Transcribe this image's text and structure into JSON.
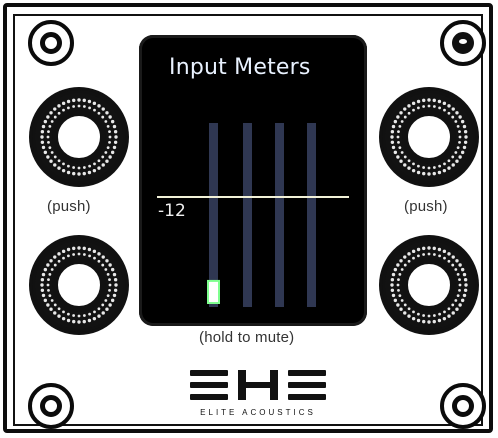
{
  "display": {
    "title": "Input Meters",
    "threshold_label": "-12"
  },
  "labels": {
    "push_left": "(push)",
    "push_right": "(push)",
    "hold_mute": "(hold to mute)"
  },
  "brand": {
    "name": "ELITE ACOUSTICS"
  },
  "meters": [
    {
      "level": 0.12,
      "active": true
    },
    {
      "level": 0.0,
      "active": false
    },
    {
      "level": 0.0,
      "active": false
    },
    {
      "level": 0.0,
      "active": false
    }
  ],
  "colors": {
    "screen_bg": "#000000",
    "meter_track": "#2f3752",
    "meter_active": "#7fff8f",
    "threshold_line": "#f2f2d8"
  }
}
